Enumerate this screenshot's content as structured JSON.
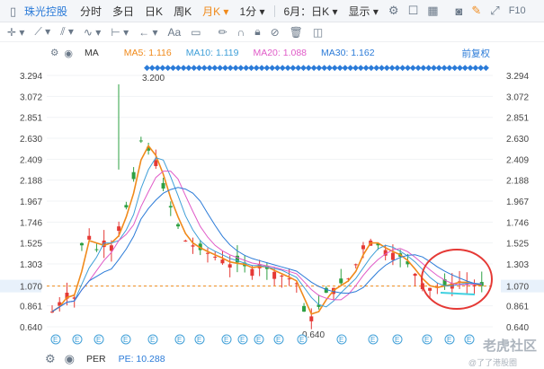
{
  "toolbar": {
    "stock_name": "珠光控股",
    "tabs": [
      "分时",
      "多日",
      "日K",
      "周K",
      "月K",
      "1分",
      "6月：日K",
      "显示"
    ],
    "f10": "F10"
  },
  "ma": {
    "label": "MA",
    "items": [
      {
        "text": "MA5: 1.116",
        "color": "#f08a1b"
      },
      {
        "text": "MA10: 1.119",
        "color": "#3f9fd8"
      },
      {
        "text": "MA20: 1.088",
        "color": "#e05bc8"
      },
      {
        "text": "MA30: 1.162",
        "color": "#2b7bd8"
      }
    ],
    "adjust": "前复权"
  },
  "chart_data": {
    "type": "candlestick",
    "y_ticks": [
      "3.294",
      "3.072",
      "2.851",
      "2.630",
      "2.409",
      "2.188",
      "1.967",
      "1.746",
      "1.525",
      "1.303",
      "1.070",
      "0.861",
      "0.640"
    ],
    "y_range": [
      0.64,
      3.294
    ],
    "current_price": "1.070",
    "high_label": "3.200",
    "low_label": "0.640"
  },
  "bottom": {
    "per": "PER",
    "pe": "PE: 10.288"
  },
  "watermark": "老虎社区",
  "watermark_sub": "@了了港股圈",
  "colors": {
    "up": "#e53935",
    "down": "#2ea043",
    "accent": "#f08a1b",
    "link": "#2b7bd8"
  }
}
